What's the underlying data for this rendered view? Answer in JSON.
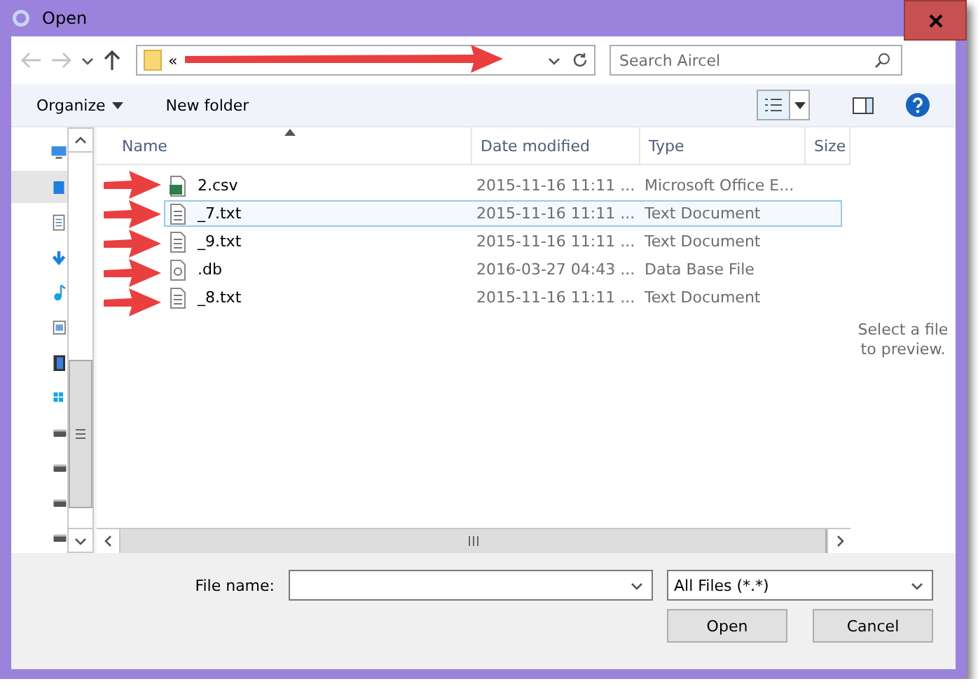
{
  "window": {
    "title": "Open"
  },
  "address": {
    "path": "«",
    "search_placeholder": "Search Aircel"
  },
  "toolbar": {
    "organize": "Organize",
    "new_folder": "New folder"
  },
  "sidebar": [
    {
      "kind": "computer",
      "selected": false
    },
    {
      "kind": "desktop",
      "selected": true
    },
    {
      "kind": "documents",
      "selected": false
    },
    {
      "kind": "downloads",
      "selected": false
    },
    {
      "kind": "music",
      "selected": false
    },
    {
      "kind": "pictures",
      "selected": false
    },
    {
      "kind": "videos",
      "selected": false
    },
    {
      "kind": "windows",
      "selected": false
    },
    {
      "kind": "drive",
      "selected": false
    },
    {
      "kind": "drive",
      "selected": false
    },
    {
      "kind": "drive",
      "selected": false
    },
    {
      "kind": "drive",
      "selected": false
    }
  ],
  "columns": [
    {
      "label": "Name",
      "sorted": true
    },
    {
      "label": "Date modified",
      "sorted": false
    },
    {
      "label": "Type",
      "sorted": false
    },
    {
      "label": "Size",
      "sorted": false
    }
  ],
  "files": [
    {
      "name": "2.csv",
      "date": "2015-11-16 11:11 ...",
      "type": "Microsoft Office E...",
      "kind": "spreadsheet",
      "selected": false
    },
    {
      "name": "_7.txt",
      "date": "2015-11-16 11:11 ...",
      "type": "Text Document",
      "kind": "text",
      "selected": true
    },
    {
      "name": "_9.txt",
      "date": "2015-11-16 11:11 ...",
      "type": "Text Document",
      "kind": "text",
      "selected": false
    },
    {
      "name": ".db",
      "date": "2016-03-27 04:43 ...",
      "type": "Data Base File",
      "kind": "database",
      "selected": false
    },
    {
      "name": "_8.txt",
      "date": "2015-11-16 11:11 ...",
      "type": "Text Document",
      "kind": "text",
      "selected": false
    }
  ],
  "preview": "Select a file to preview.",
  "file_name": {
    "label": "File name:"
  },
  "filter": "All Files (*.*)",
  "buttons": [
    "Open",
    "Cancel"
  ]
}
